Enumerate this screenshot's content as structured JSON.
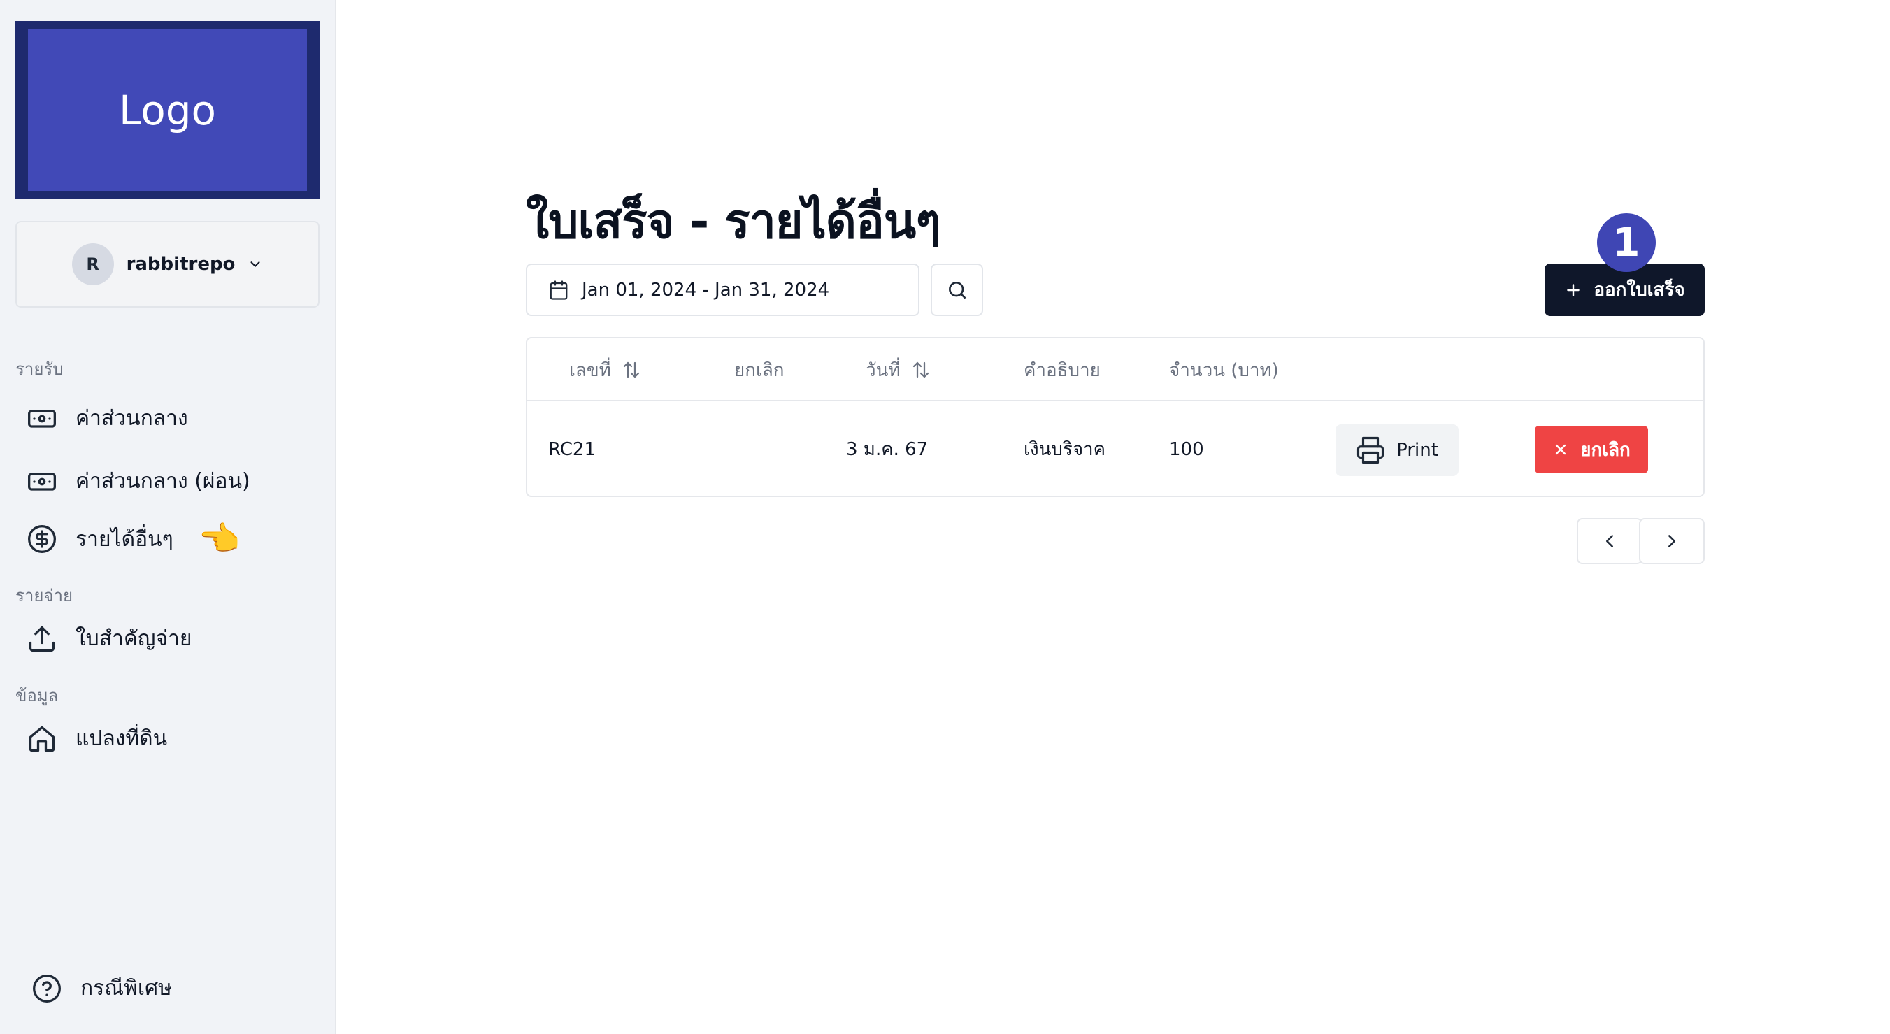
{
  "sidebar": {
    "logo_text": "Logo",
    "workspace": {
      "avatar_initial": "R",
      "name": "rabbitrepo"
    },
    "sections": {
      "income": "รายรับ",
      "expense": "รายจ่าย",
      "data": "ข้อมูล"
    },
    "items": [
      {
        "label": "ค่าส่วนกลาง",
        "icon": "banknote-icon"
      },
      {
        "label": "ค่าส่วนกลาง (ผ่อน)",
        "icon": "banknote-icon"
      },
      {
        "label": "รายได้อื่นๆ",
        "icon": "dollar-circle-icon"
      },
      {
        "label": "ใบสำคัญจ่าย",
        "icon": "upload-icon"
      },
      {
        "label": "แปลงที่ดิน",
        "icon": "home-icon"
      }
    ],
    "pointer_emoji": "👈",
    "footer_item": {
      "label": "กรณีพิเศษ",
      "icon": "help-circle-icon"
    }
  },
  "main": {
    "title": "ใบเสร็จ - รายได้อื่นๆ",
    "date_range": "Jan 01, 2024 - Jan 31, 2024",
    "issue_button": "ออกใบเสร็จ",
    "step_badge": "1",
    "table": {
      "headers": [
        "เลขที่",
        "ยกเลิก",
        "วันที่",
        "คำอธิบาย",
        "จำนวน (บาท)"
      ],
      "rows": [
        {
          "number": "RC21",
          "cancelled": "",
          "date": "3 ม.ค. 67",
          "description": "เงินบริจาค",
          "amount": "100",
          "print_label": "Print",
          "cancel_label": "ยกเลิก"
        }
      ]
    }
  },
  "colors": {
    "primary_dark": "#0f172a",
    "logo_bg": "#4149b7",
    "badge": "#3f46b4",
    "danger": "#ef4444"
  }
}
